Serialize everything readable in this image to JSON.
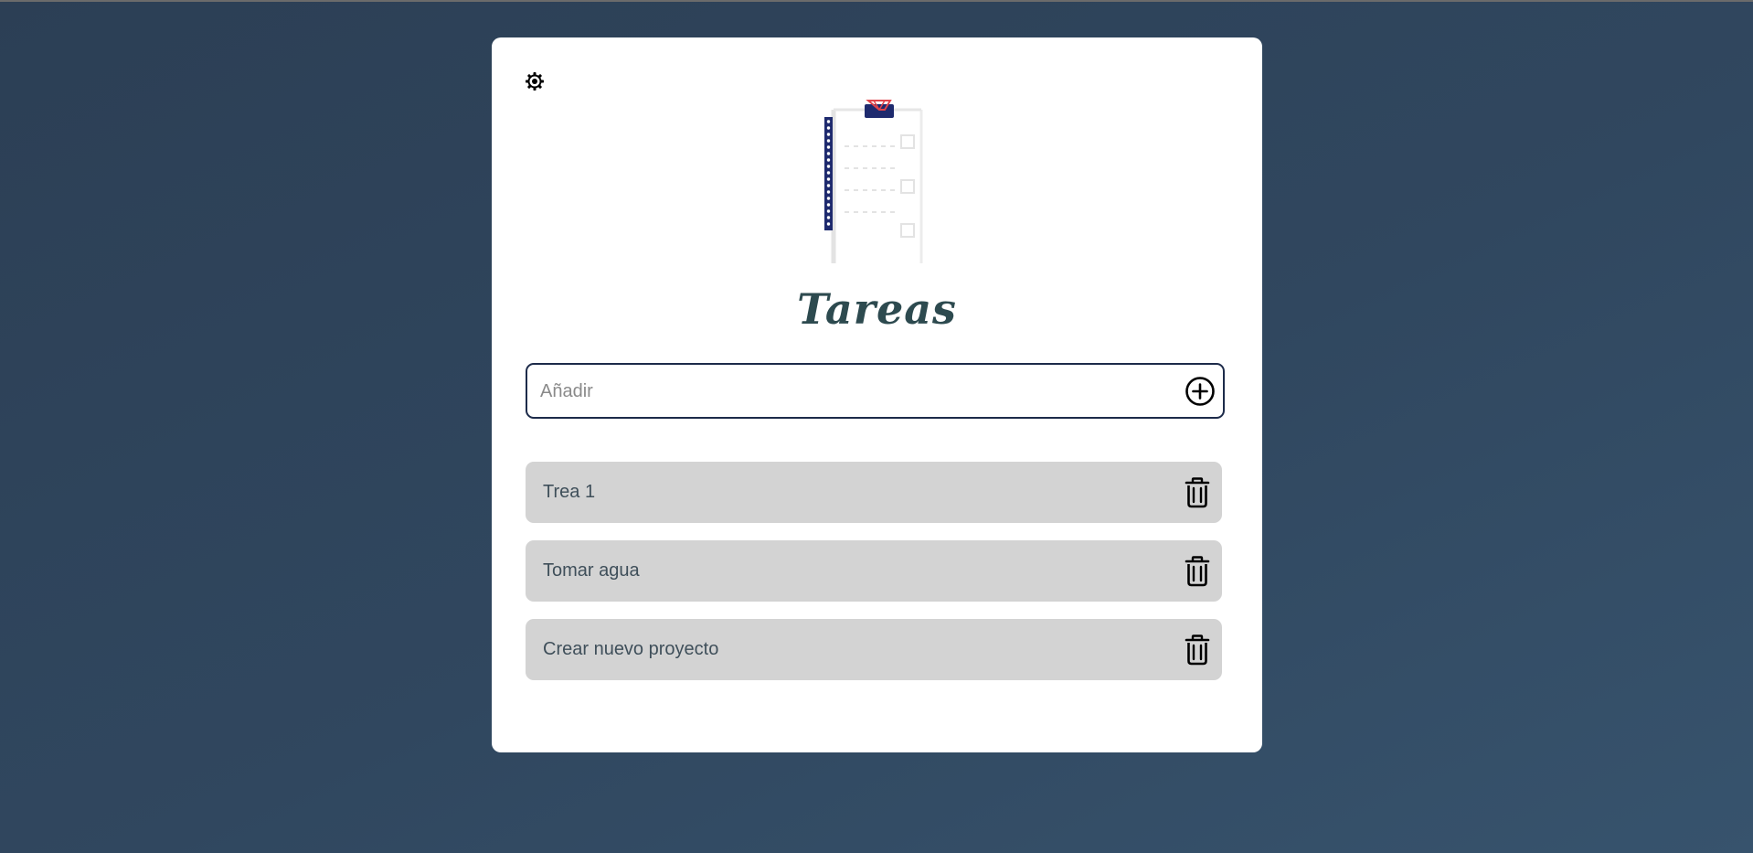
{
  "header": {
    "theme_toggle_icon": "sun-gear-icon",
    "illustration": "clipboard-checklist-illustration",
    "title": "Tareas"
  },
  "add_form": {
    "placeholder": "Añadir",
    "value": "",
    "add_icon": "plus-circle-icon"
  },
  "tasks": [
    {
      "text": "Trea 1",
      "delete_icon": "trash-icon"
    },
    {
      "text": "Tomar agua",
      "delete_icon": "trash-icon"
    },
    {
      "text": "Crear nuevo proyecto",
      "delete_icon": "trash-icon"
    }
  ],
  "colors": {
    "background_start": "#2c3f55",
    "background_end": "#37536d",
    "card": "#ffffff",
    "title": "#2d4a4f",
    "input_border": "#1d2b4a",
    "task_bg": "#d3d3d3",
    "task_text": "#3f4f5a",
    "clip_navy": "#1e2a6e",
    "clip_red": "#e0444a"
  }
}
